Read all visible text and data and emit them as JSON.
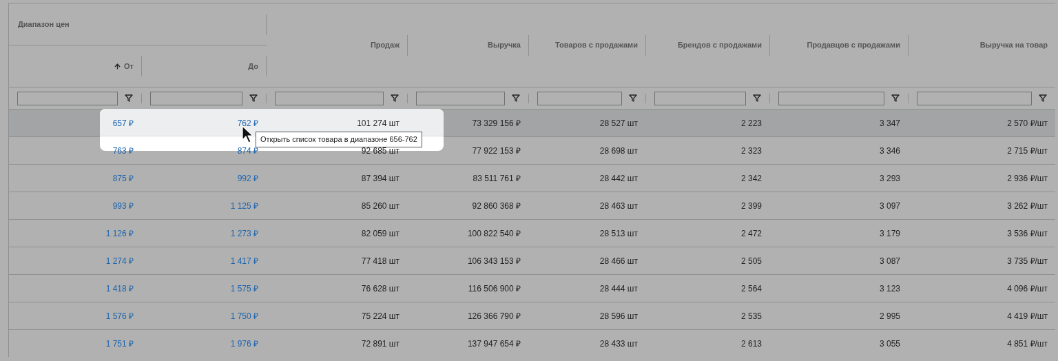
{
  "table": {
    "header": [
      {
        "kind": "group",
        "label": "Диапазон цен",
        "columns": [
          {
            "label": "От",
            "sorted": true
          },
          {
            "label": "До",
            "sorted": false
          }
        ]
      },
      {
        "kind": "column",
        "label": "Продаж",
        "sorted": false
      },
      {
        "kind": "column",
        "label": "Выручка",
        "sorted": false
      },
      {
        "kind": "column",
        "label": "Товаров с продажами",
        "sorted": false
      },
      {
        "kind": "column",
        "label": "Брендов с продажами",
        "sorted": false
      },
      {
        "kind": "column",
        "label": "Продавцов с продажами",
        "sorted": false
      },
      {
        "kind": "column",
        "label": "Выручка на товар",
        "sorted": false
      }
    ],
    "rows": [
      {
        "selected": true,
        "cells": [
          "657 ₽",
          "762 ₽",
          "101 274 шт",
          "73 329 156 ₽",
          "28 527 шт",
          "2 223",
          "3 347",
          "2 570 ₽/шт"
        ]
      },
      {
        "selected": false,
        "cells": [
          "763 ₽",
          "874 ₽",
          "92 685 шт",
          "77 922 153 ₽",
          "28 698 шт",
          "2 323",
          "3 346",
          "2 715 ₽/шт"
        ]
      },
      {
        "selected": false,
        "cells": [
          "875 ₽",
          "992 ₽",
          "87 394 шт",
          "83 511 761 ₽",
          "28 442 шт",
          "2 342",
          "3 293",
          "2 936 ₽/шт"
        ]
      },
      {
        "selected": false,
        "cells": [
          "993 ₽",
          "1 125 ₽",
          "85 260 шт",
          "92 860 368 ₽",
          "28 463 шт",
          "2 399",
          "3 097",
          "3 262 ₽/шт"
        ]
      },
      {
        "selected": false,
        "cells": [
          "1 126 ₽",
          "1 273 ₽",
          "82 059 шт",
          "100 822 540 ₽",
          "28 513 шт",
          "2 472",
          "3 179",
          "3 536 ₽/шт"
        ]
      },
      {
        "selected": false,
        "cells": [
          "1 274 ₽",
          "1 417 ₽",
          "77 418 шт",
          "106 343 153 ₽",
          "28 466 шт",
          "2 505",
          "3 087",
          "3 735 ₽/шт"
        ]
      },
      {
        "selected": false,
        "cells": [
          "1 418 ₽",
          "1 575 ₽",
          "76 628 шт",
          "116 506 900 ₽",
          "28 444 шт",
          "2 564",
          "3 123",
          "4 096 ₽/шт"
        ]
      },
      {
        "selected": false,
        "cells": [
          "1 576 ₽",
          "1 750 ₽",
          "75 224 шт",
          "126 366 790 ₽",
          "28 596 шт",
          "2 535",
          "2 995",
          "4 419 ₽/шт"
        ]
      },
      {
        "selected": false,
        "cells": [
          "1 751 ₽",
          "1 976 ₽",
          "72 891 шт",
          "137 947 654 ₽",
          "28 433 шт",
          "2 613",
          "3 055",
          "4 851 ₽/шт"
        ]
      }
    ]
  },
  "tooltip": {
    "text": "Открыть список товара в диапазоне 656-762"
  }
}
